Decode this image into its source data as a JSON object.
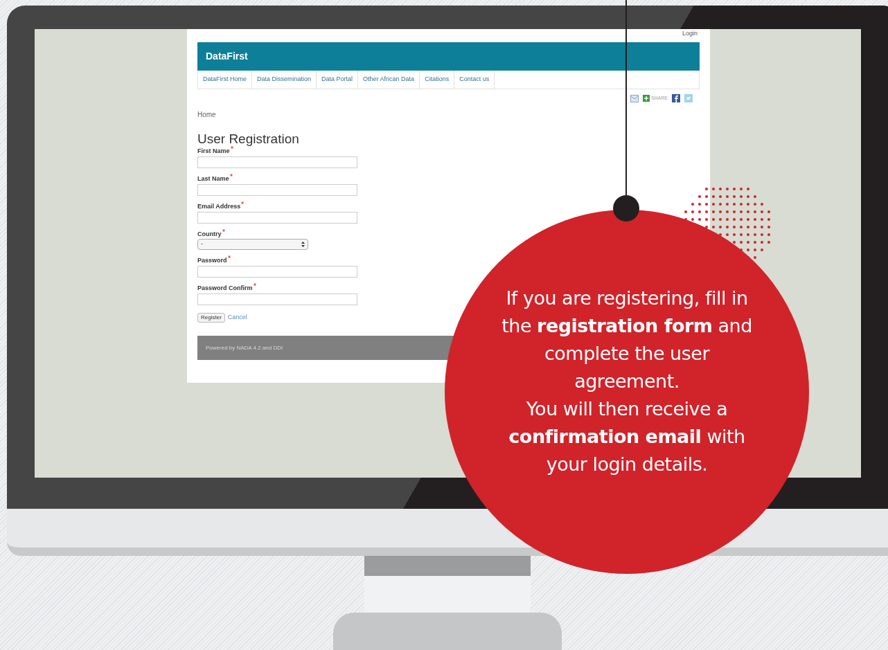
{
  "site": {
    "login": "Login",
    "brand": "DataFirst",
    "nav": [
      {
        "label": "DataFirst Home"
      },
      {
        "label": "Data Dissemination"
      },
      {
        "label": "Data Portal"
      },
      {
        "label": "Other African Data"
      },
      {
        "label": "Citations"
      },
      {
        "label": "Contact us"
      }
    ],
    "share": {
      "label": "SHARE"
    },
    "breadcrumb": "Home",
    "heading": "User Registration",
    "fields": [
      {
        "kind": "text",
        "label": "First Name",
        "required": true
      },
      {
        "kind": "text",
        "label": "Last Name",
        "required": true
      },
      {
        "kind": "text",
        "label": "Email Address",
        "required": true
      },
      {
        "kind": "select",
        "label": "Country",
        "required": true,
        "value": "-"
      },
      {
        "kind": "text",
        "label": "Password",
        "required": true
      },
      {
        "kind": "text",
        "label": "Password Confirm",
        "required": true
      }
    ],
    "buttons": {
      "submit": "Register",
      "cancel": "Cancel"
    },
    "footer": "Powered by NADA 4.2 and DDI"
  },
  "callout": {
    "paragraphs": [
      "If you are registering, fill in the **registration form** and complete the user agreement.",
      "You will then receive a **confirmation email** with your login details."
    ]
  }
}
